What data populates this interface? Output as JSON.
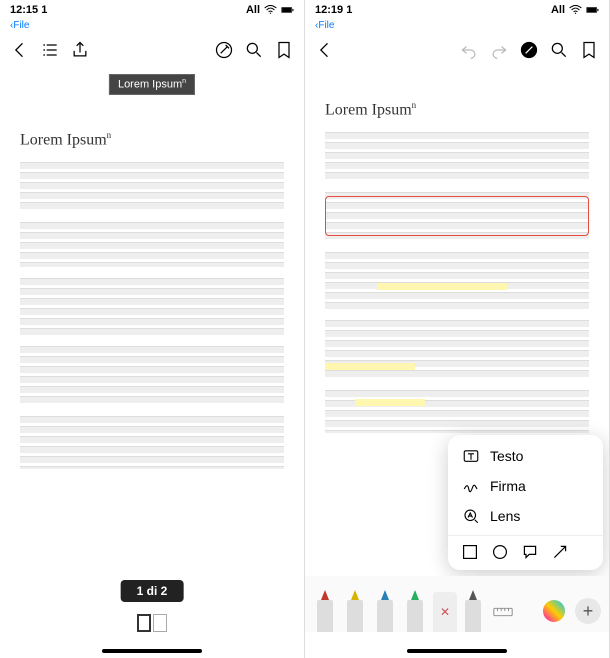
{
  "left": {
    "status": {
      "time": "12:15",
      "sim": "1",
      "carrier": "All",
      "battery": "full"
    },
    "breadcrumb": {
      "back_label": "File"
    },
    "thumbnail_label": "Lorem Ipsum",
    "doc_title": "Lorem Ipsum",
    "page_counter": "1 di 2"
  },
  "right": {
    "status": {
      "time": "12:19",
      "sim": "1",
      "carrier": "All",
      "battery": "full"
    },
    "breadcrumb": {
      "back_label": "File"
    },
    "doc_title": "Lorem Ipsum",
    "tool_menu": {
      "text_label": "Testo",
      "signature_label": "Firma",
      "lens_label": "Lens"
    },
    "drawing": {
      "pen_colors": [
        "#c0392b",
        "#d8b400",
        "#2980b9",
        "#27ae60",
        "#555555"
      ]
    }
  },
  "icons": {
    "back": "chevron-left",
    "list": "bullet-list",
    "share": "share-up",
    "markup": "pen-circle",
    "search": "magnifier",
    "bookmark": "bookmark-outline",
    "undo": "undo-arrow",
    "redo": "redo-arrow",
    "text_tool": "text-box",
    "signature_tool": "signature-squiggle",
    "lens_tool": "magnify-a",
    "shape_square": "square",
    "shape_circle": "circle",
    "shape_bubble": "speech-bubble",
    "shape_arrow": "arrow-diag",
    "color_picker": "rainbow-circle",
    "add": "plus"
  }
}
